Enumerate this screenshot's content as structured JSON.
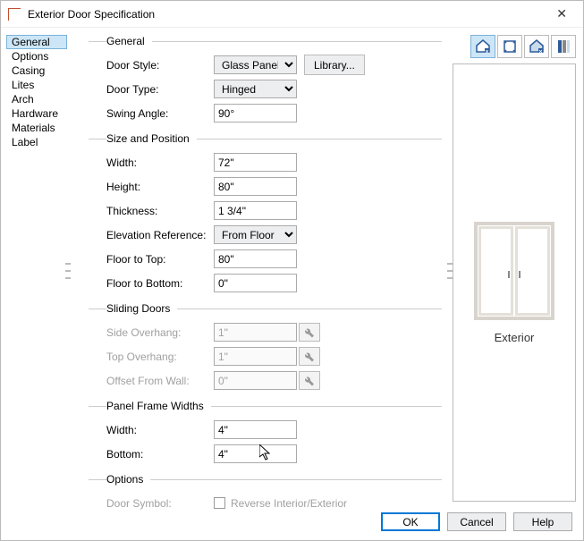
{
  "title": "Exterior Door Specification",
  "sidebar": {
    "items": [
      {
        "label": "General"
      },
      {
        "label": "Options"
      },
      {
        "label": "Casing"
      },
      {
        "label": "Lites"
      },
      {
        "label": "Arch"
      },
      {
        "label": "Hardware"
      },
      {
        "label": "Materials"
      },
      {
        "label": "Label"
      }
    ]
  },
  "groups": {
    "general": {
      "legend": "General",
      "door_style_label": "Door Style:",
      "door_style_value": "Glass Panel",
      "library_btn": "Library...",
      "door_type_label": "Door Type:",
      "door_type_value": "Hinged",
      "swing_angle_label": "Swing Angle:",
      "swing_angle_value": "90°"
    },
    "size": {
      "legend": "Size and Position",
      "width_label": "Width:",
      "width_value": "72\"",
      "height_label": "Height:",
      "height_value": "80\"",
      "thickness_label": "Thickness:",
      "thickness_value": "1 3/4\"",
      "elev_ref_label": "Elevation Reference:",
      "elev_ref_value": "From Floor",
      "floor_top_label": "Floor to Top:",
      "floor_top_value": "80\"",
      "floor_bottom_label": "Floor to Bottom:",
      "floor_bottom_value": "0\""
    },
    "sliding": {
      "legend": "Sliding Doors",
      "side_label": "Side Overhang:",
      "side_value": "1\"",
      "top_label": "Top Overhang:",
      "top_value": "1\"",
      "offset_label": "Offset From Wall:",
      "offset_value": "0\""
    },
    "panel": {
      "legend": "Panel Frame Widths",
      "width_label": "Width:",
      "width_value": "4\"",
      "bottom_label": "Bottom:",
      "bottom_value": "4\""
    },
    "options": {
      "legend": "Options",
      "symbol_label": "Door Symbol:",
      "reverse_label": "Reverse Interior/Exterior"
    }
  },
  "preview": {
    "label": "Exterior"
  },
  "buttons": {
    "ok": "OK",
    "cancel": "Cancel",
    "help": "Help"
  }
}
